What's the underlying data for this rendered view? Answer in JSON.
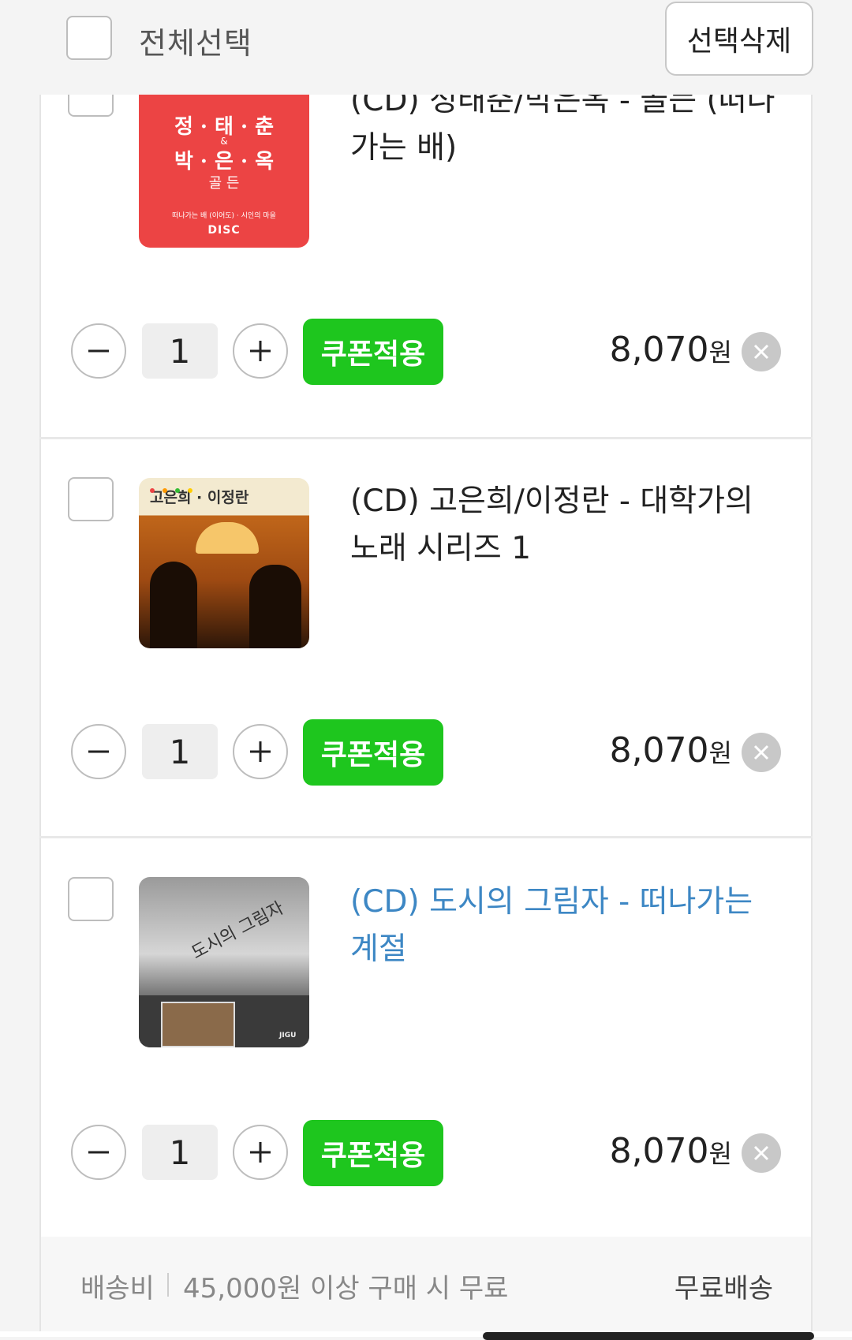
{
  "header": {
    "select_all_label": "전체선택",
    "delete_selected_label": "선택삭제"
  },
  "items": [
    {
      "title": "(CD) 정태춘/박은옥 - 골든 (떠나가는 배)",
      "cover_lines": [
        "정 · 태 · 춘",
        "&",
        "박 · 은 · 옥",
        "골 든",
        "떠나가는 배 (이어도) · 시인의 마을",
        "DISC"
      ],
      "quantity": "1",
      "coupon_label": "쿠폰적용",
      "price": "8,070",
      "currency": "원"
    },
    {
      "title": "(CD) 고은희/이정란 - 대학가의 노래 시리즈 1",
      "cover_lines": [
        "고은희 · 이정란"
      ],
      "quantity": "1",
      "coupon_label": "쿠폰적용",
      "price": "8,070",
      "currency": "원"
    },
    {
      "title": "(CD) 도시의 그림자 - 떠나가는 계절",
      "cover_lines": [
        "도시의 그림자",
        "JIGU"
      ],
      "quantity": "1",
      "coupon_label": "쿠폰적용",
      "price": "8,070",
      "currency": "원"
    }
  ],
  "shipping": {
    "label": "배송비",
    "condition": "45,000원 이상 구매 시 무료",
    "status": "무료배송"
  },
  "colors": {
    "coupon_green": "#1ec61e",
    "link_blue": "#3d87c4",
    "cover1_red": "#ec4444"
  },
  "icons": [
    "minus-icon",
    "plus-icon",
    "close-icon"
  ]
}
